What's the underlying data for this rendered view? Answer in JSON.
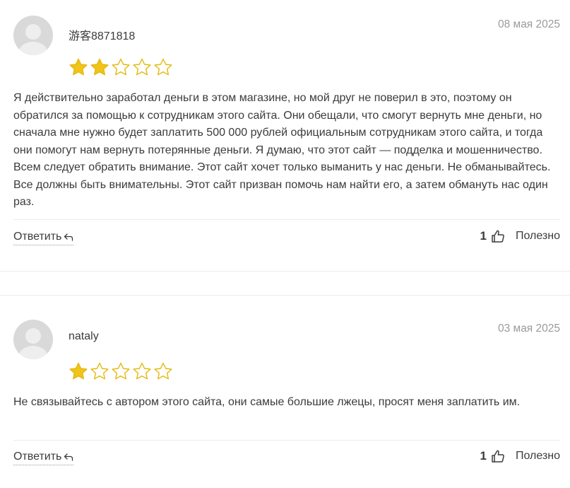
{
  "colors": {
    "star_filled": "#f0c419",
    "star_outline": "#e5b80b",
    "text": "#3b3b3b",
    "muted": "#9a9a9a",
    "divider": "#ececec"
  },
  "reviews": [
    {
      "author": "游客8871818",
      "date": "08 мая 2025",
      "rating": 2,
      "max_rating": 5,
      "text": "Я действительно заработал деньги в этом магазине, но мой друг не поверил в это, поэтому он обратился за помощью к сотрудникам этого сайта. Они обещали, что смогут вернуть мне деньги, но сначала мне нужно будет заплатить 500 000 рублей официальным сотрудникам этого сайта, и тогда они помогут нам вернуть потерянные деньги. Я думаю, что этот сайт — подделка и мошенничество. Всем следует обратить внимание. Этот сайт хочет только выманить у нас деньги. Не обманывайтесь. Все должны быть внимательны. Этот сайт призван помочь нам найти его, а затем обмануть нас один раз.",
      "reply_label": "Ответить",
      "likes": "1",
      "useful_label": "Полезно",
      "avatar_icon": "user-avatar-placeholder",
      "reply_icon": "reply-arrow-icon",
      "thumb_icon": "thumbs-up-icon"
    },
    {
      "author": "nataly",
      "date": "03 мая 2025",
      "rating": 1,
      "max_rating": 5,
      "text": "Не связывайтесь с автором этого сайта, они самые большие лжецы, просят меня заплатить им.",
      "reply_label": "Ответить",
      "likes": "1",
      "useful_label": "Полезно",
      "avatar_icon": "user-avatar-placeholder",
      "reply_icon": "reply-arrow-icon",
      "thumb_icon": "thumbs-up-icon"
    }
  ]
}
